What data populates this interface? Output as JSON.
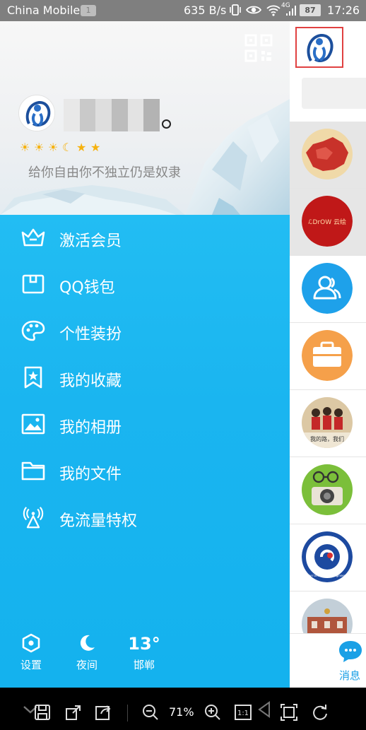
{
  "status_bar": {
    "carrier": "China Mobile",
    "notification_count": "1",
    "data_rate": "635 B/s",
    "network_type": "4G",
    "battery": "87",
    "time": "17:26"
  },
  "profile": {
    "level_icons": [
      "sun",
      "sun",
      "sun",
      "moon",
      "star",
      "star"
    ],
    "signature": "给你自由你不独立仍是奴隶"
  },
  "menu": {
    "items": [
      {
        "label": "激活会员",
        "icon": "crown-icon"
      },
      {
        "label": "QQ钱包",
        "icon": "wallet-icon"
      },
      {
        "label": "个性装扮",
        "icon": "palette-icon"
      },
      {
        "label": "我的收藏",
        "icon": "bookmark-star-icon"
      },
      {
        "label": "我的相册",
        "icon": "photo-icon"
      },
      {
        "label": "我的文件",
        "icon": "folder-icon"
      },
      {
        "label": "免流量特权",
        "icon": "signal-tower-icon"
      }
    ]
  },
  "footer": {
    "settings_label": "设置",
    "night_label": "夜间",
    "temperature": "13°",
    "city": "邯郸"
  },
  "strip": {
    "conversations": [
      {
        "avatar": "red-map-avatar",
        "highlighted": true
      },
      {
        "avatar": "red-circle-logo-avatar",
        "text": "ℒDrOW 云绘",
        "highlighted": true
      },
      {
        "avatar": "contacts-icon",
        "color": "#1ea1ea"
      },
      {
        "avatar": "briefcase-icon",
        "color": "#f5a04a"
      },
      {
        "avatar": "group-photo-avatar",
        "text": "我的路，我们"
      },
      {
        "avatar": "camera-avatar"
      },
      {
        "avatar": "university-logo-avatar",
        "text": "Hebei University of Engineering"
      },
      {
        "avatar": "building-photo-avatar"
      }
    ],
    "messages_label": "消息"
  },
  "toolbar": {
    "zoom": "71%",
    "actual_size": "1:1"
  },
  "colors": {
    "accent_blue": "#1ab8f0",
    "status_bar": "#7f7f7f",
    "level_gold": "#f6b20e"
  }
}
